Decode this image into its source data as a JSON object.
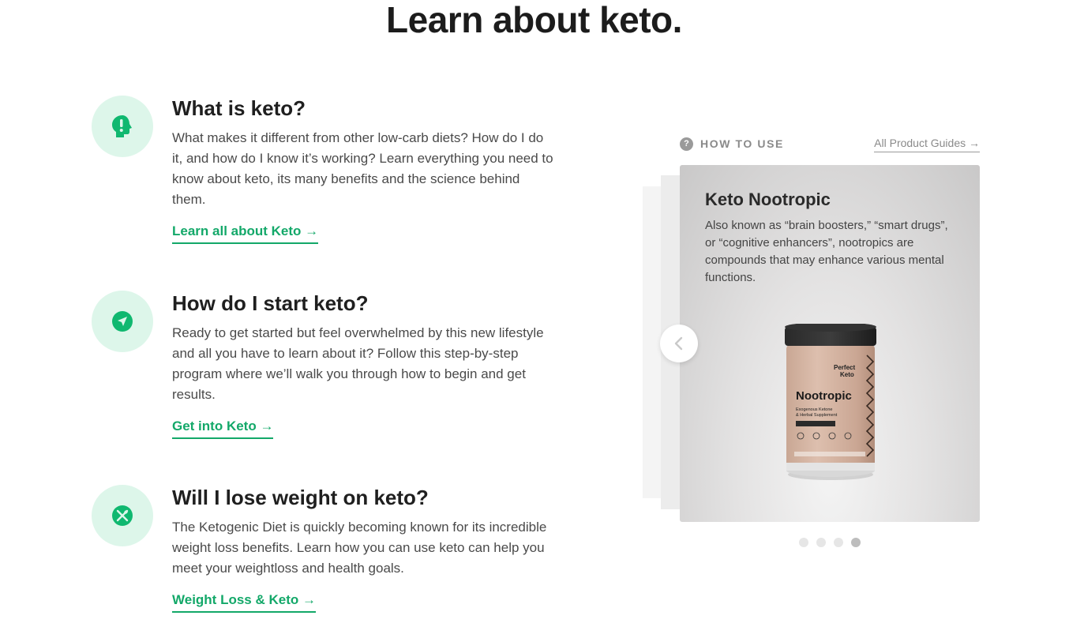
{
  "page": {
    "title": "Learn about keto."
  },
  "topics": [
    {
      "title": "What is keto?",
      "text": "What makes it different from other low-carb diets? How do I do it, and how do I know it’s working? Learn everything you need to know about keto, its many benefits and the science behind them.",
      "link": "Learn all about Keto →",
      "icon": "head-exclamation-icon"
    },
    {
      "title": "How do I start keto?",
      "text": "Ready to get started but feel overwhelmed by this new lifestyle and all you have to learn about it? Follow this step-by-step program where we’ll walk you through how to begin and get results.",
      "link": "Get into Keto →",
      "icon": "navigation-arrow-icon"
    },
    {
      "title": "Will I lose weight on keto?",
      "text": "The Ketogenic Diet is quickly becoming known for its incredible weight loss benefits. Learn how you can use keto can help you meet your weightloss and health goals.",
      "link": "Weight Loss & Keto →",
      "icon": "utensils-icon"
    }
  ],
  "how_to_use": {
    "help_glyph": "?",
    "label": "HOW TO USE",
    "guides_link": "All Product Guides →",
    "card": {
      "title": "Keto Nootropic",
      "text": "Also known as “brain boosters,” “smart drugs”, or “cognitive enhancers”, nootropics are compounds that may enhance various mental functions.",
      "product": {
        "brand": "Perfect Keto",
        "name": "Nootropic",
        "subtitle": "Exogenous Ketone & Herbal Supplement"
      }
    },
    "carousel": {
      "slide_count": 4,
      "active_index": 3
    }
  },
  "colors": {
    "accent": "#13a869",
    "icon_bg": "#ddf6ea",
    "icon_fg": "#10b870"
  }
}
